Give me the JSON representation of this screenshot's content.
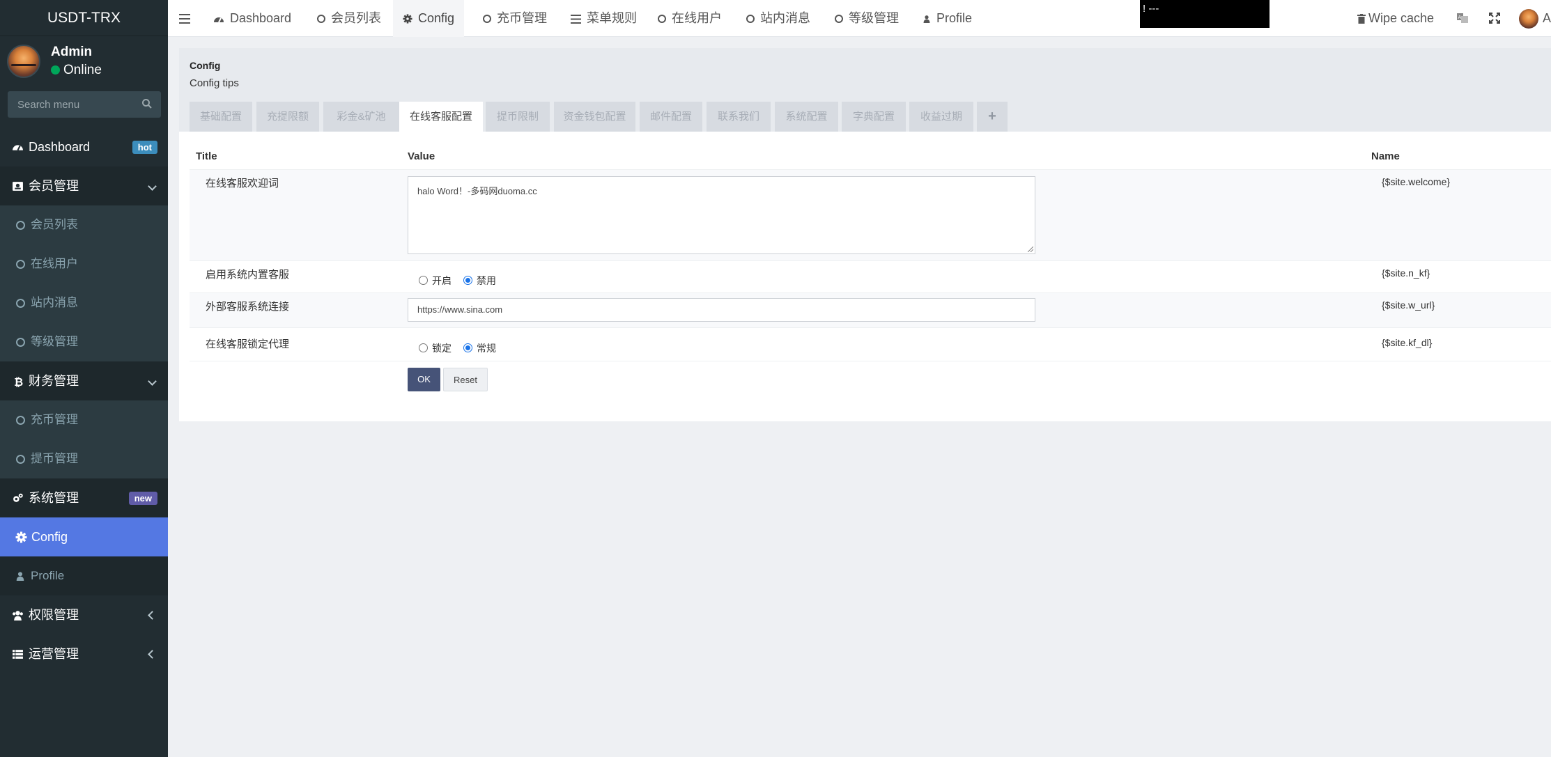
{
  "brand": "USDT-TRX",
  "user": {
    "name": "Admin",
    "status": "Online"
  },
  "search": {
    "placeholder": "Search menu"
  },
  "sidebar": {
    "dashboard": {
      "label": "Dashboard",
      "badge": "hot"
    },
    "member_mgmt": {
      "label": "会员管理"
    },
    "member_sub": [
      "会员列表",
      "在线用户",
      "站内消息",
      "等级管理"
    ],
    "finance_mgmt": {
      "label": "财务管理"
    },
    "finance_sub": [
      "充币管理",
      "提币管理"
    ],
    "system_mgmt": {
      "label": "系统管理",
      "badge": "new"
    },
    "config": "Config",
    "profile": "Profile",
    "auth_mgmt": "权限管理",
    "ops_mgmt": "运营管理"
  },
  "navbar": {
    "items": [
      "Dashboard",
      "会员列表",
      "Config",
      "充币管理",
      "菜单规则",
      "在线用户",
      "站内消息",
      "等级管理",
      "Profile"
    ],
    "black_box_text": "!  ---",
    "wipe_cache": "Wipe cache",
    "user_initial": "A"
  },
  "content": {
    "title": "Config",
    "tips": "Config tips",
    "tabs": [
      "基础配置",
      "充提限额",
      "彩金&矿池",
      "在线客服配置",
      "提币限制",
      "资金钱包配置",
      "邮件配置",
      "联系我们",
      "系统配置",
      "字典配置",
      "收益过期",
      "+"
    ],
    "active_tab": "在线客服配置",
    "table": {
      "headers": {
        "title": "Title",
        "value": "Value",
        "name": "Name"
      },
      "rows": [
        {
          "title": "在线客服欢迎词",
          "value": "halo Word！-多码网duoma.cc",
          "name": "{$site.welcome}"
        },
        {
          "title": "启用系统内置客服",
          "options": [
            "开启",
            "禁用"
          ],
          "selected": "禁用",
          "name": "{$site.n_kf}"
        },
        {
          "title": "外部客服系统连接",
          "value": "https://www.sina.com",
          "name": "{$site.w_url}"
        },
        {
          "title": "在线客服锁定代理",
          "options": [
            "锁定",
            "常规"
          ],
          "selected": "常规",
          "name": "{$site.kf_dl}"
        }
      ]
    },
    "buttons": {
      "ok": "OK",
      "reset": "Reset"
    }
  },
  "colors": {
    "sidebar_bg": "#222d32",
    "active_menu": "#5478e3",
    "ok_button": "#465378",
    "badge_hot": "#3c8dbc",
    "badge_new": "#605ca8"
  }
}
